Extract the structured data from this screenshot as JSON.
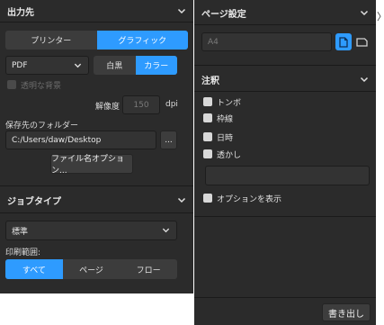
{
  "output_section": {
    "title": "出力先",
    "destination_options": [
      "プリンター",
      "グラフィック"
    ],
    "selected_destination": "グラフィック",
    "format_value": "PDF",
    "color_options": [
      "白黒",
      "カラー"
    ],
    "selected_color": "カラー",
    "transparent_bg_label": "透明な背景",
    "resolution_label": "解像度",
    "resolution_value": "150",
    "resolution_unit": "dpi",
    "save_folder_label": "保存先のフォルダー",
    "save_folder_value": "C:/Users/daw/Desktop",
    "browse_label": "...",
    "filename_options_label": "ファイル名オプション..."
  },
  "job_section": {
    "title": "ジョブタイプ",
    "job_type_value": "標準",
    "print_range_label": "印刷範囲:",
    "range_options": [
      "すべて",
      "ページ",
      "フロー"
    ],
    "selected_range": "すべて"
  },
  "page_section": {
    "title": "ページ設定",
    "paper_size_value": "A4",
    "orientation_selected": "portrait"
  },
  "notes_section": {
    "title": "注釈",
    "items": [
      "トンボ",
      "枠線",
      "日時",
      "透かし"
    ],
    "watermark_text_value": "",
    "show_options_label": "オプションを表示"
  },
  "footer": {
    "export_label": "書き出し"
  },
  "side_arrow": "〉",
  "colors": {
    "panel_bg": "#2b2b2b",
    "accent": "#2e9bff",
    "field_bg": "#333333"
  }
}
